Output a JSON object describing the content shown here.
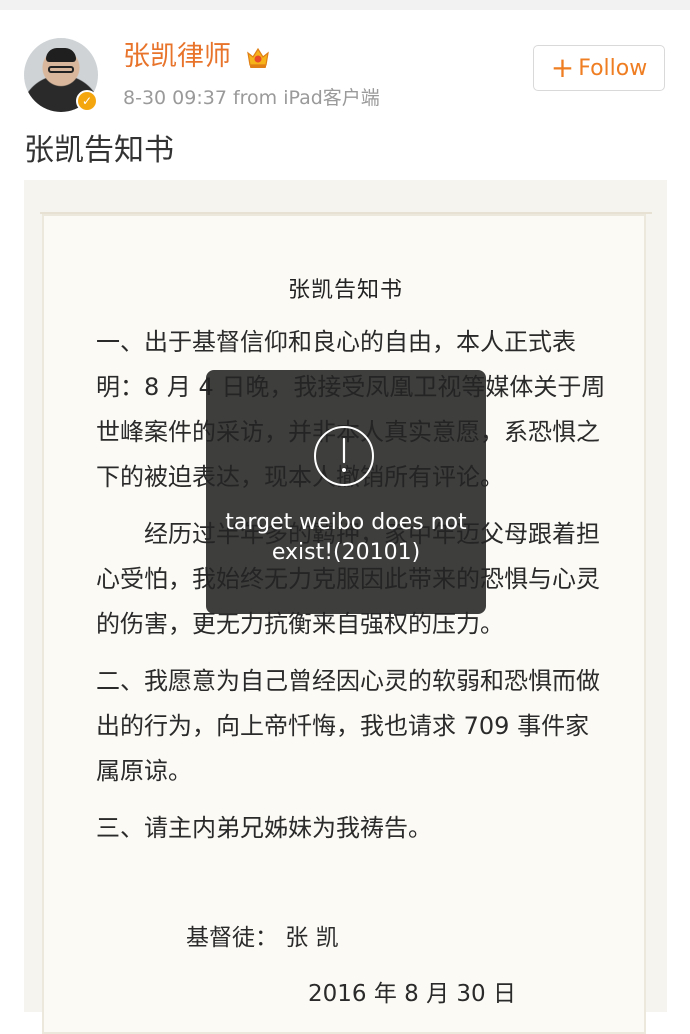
{
  "post": {
    "author": {
      "name": "张凯律师"
    },
    "meta": "8-30 09:37  from iPad客户端",
    "follow_label": "Follow",
    "text": "张凯告知书"
  },
  "document": {
    "title": "张凯告知书",
    "paragraphs": [
      "一、出于基督信仰和良心的自由，本人正式表明：8 月 4 日晚，我接受凤凰卫视等媒体关于周世峰案件的采访，并非本人真实意愿，系恐惧之下的被迫表达，现本人撤销所有评论。",
      "经历过半年多的羁押，家中年迈父母跟着担心受怕，我始终无力克服因此带来的恐惧与心灵的伤害，更无力抗衡来自强权的压力。",
      "二、我愿意为自己曾经因心灵的软弱和恐惧而做出的行为，向上帝忏悔，我也请求 709 事件家属原谅。",
      "三、请主内弟兄姊妹为我祷告。"
    ],
    "signature": "基督徒：  张 凯",
    "date": "2016 年 8 月 30 日"
  },
  "toast": {
    "message": "target weibo does not exist!(20101)",
    "icon": "exclamation-circle-icon"
  },
  "colors": {
    "username": "#e8742c",
    "follow_text": "#ef7d22",
    "verified_badge": "#f4a60f",
    "toast_bg": "#232323"
  }
}
